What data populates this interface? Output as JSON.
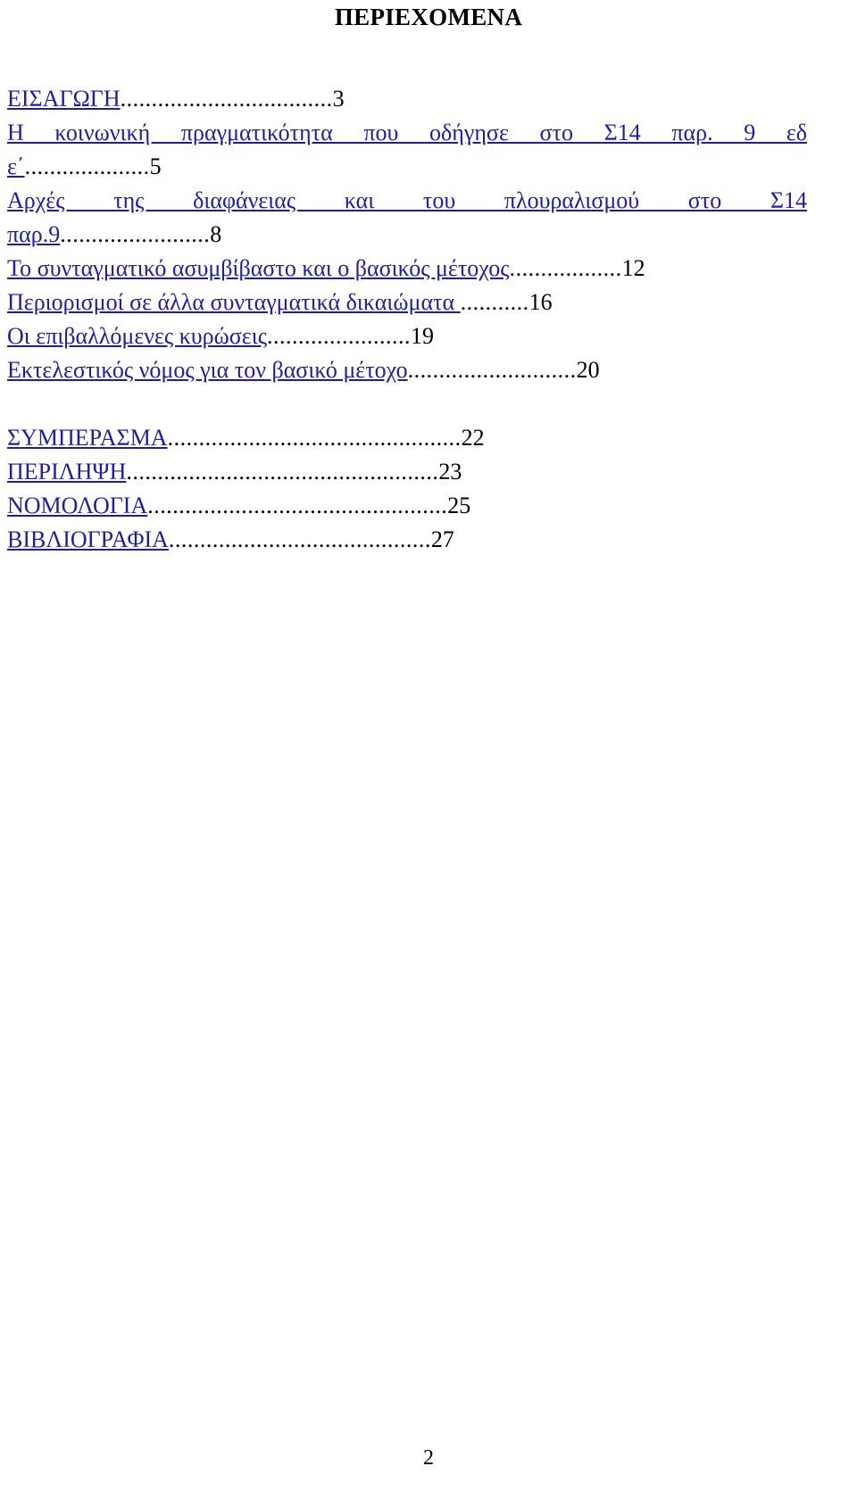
{
  "document": {
    "title": "ΠΕΡΙΕΧΟΜΕΝΑ",
    "folio": "2",
    "link_color": "#1e1ea0",
    "text_color": "#000000"
  },
  "toc": {
    "entries": [
      {
        "id": "eisagogi",
        "title": "ΕΙΣΑΓΩΓΗ",
        "leader": "..................................",
        "page": "3",
        "wrapped": false
      },
      {
        "id": "koinoniki-pragmatikotita",
        "title": "Η κοινωνική πραγματικότητα που οδήγησε στο Σ14 παρ. 9 εδ",
        "continuation": "ε΄",
        "leader": "....................",
        "page": "5",
        "wrapped": true
      },
      {
        "id": "arches-diafaneias",
        "title": "Αρχές της διαφάνειας και του πλουραλισμού στο Σ14",
        "continuation": "παρ.9",
        "leader": "........................",
        "page": "8",
        "wrapped": true
      },
      {
        "id": "syntagmatiko-asymvivasto",
        "title": "Το συνταγματικό ασυμβίβαστο και ο βασικός μέτοχος",
        "leader": "..................",
        "page": "12",
        "wrapped": false
      },
      {
        "id": "periorismoi-dikaiomata",
        "title": "Περιορισμοί σε άλλα συνταγματικά δικαιώματα ",
        "leader": "...........",
        "page": "16",
        "wrapped": false
      },
      {
        "id": "epivallomenes-kyroseis",
        "title": "Οι επιβαλλόμενες κυρώσεις",
        "leader": ".......................",
        "page": "19",
        "wrapped": false
      },
      {
        "id": "ektelestikos-nomos",
        "title": "Εκτελεστικός νόμος για τον βασικό μέτοχο",
        "leader": "...........................",
        "page": "20",
        "wrapped": false
      }
    ],
    "entries_back": [
      {
        "id": "symperasma",
        "title": "ΣΥΜΠΕΡΑΣΜΑ",
        "leader": "...............................................",
        "page": "22"
      },
      {
        "id": "perilipsi",
        "title": "ΠΕΡΙΛΗΨΗ",
        "leader": "..................................................",
        "page": "23"
      },
      {
        "id": "nomologia",
        "title": "ΝΟΜΟΛΟΓΙΑ",
        "leader": "................................................",
        "page": "25"
      },
      {
        "id": "vivliografia",
        "title": "ΒΙΒΛΙΟΓΡΑΦΙΑ",
        "leader": "..........................................",
        "page": "27"
      }
    ]
  }
}
